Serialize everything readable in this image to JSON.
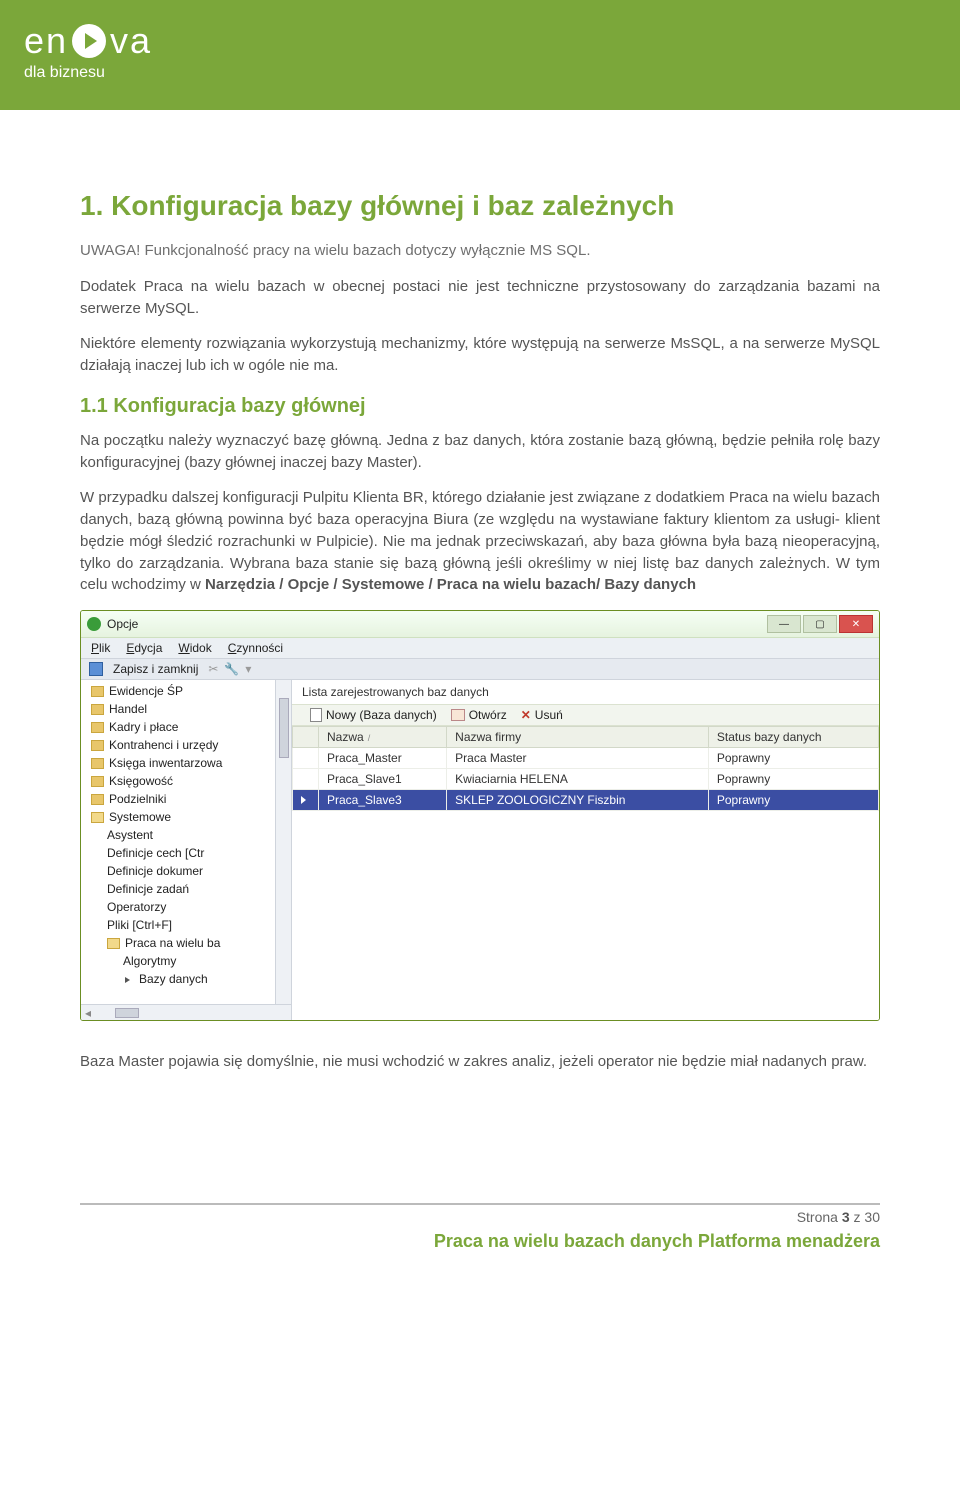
{
  "brand": {
    "name1": "en",
    "name2": "va",
    "tagline": "dla biznesu"
  },
  "doc": {
    "h1": "1. Konfiguracja bazy głównej i baz zależnych",
    "warn": "UWAGA! Funkcjonalność pracy na wielu bazach dotyczy wyłącznie MS SQL.",
    "p1": "Dodatek Praca na wielu bazach w obecnej postaci nie jest techniczne przystosowany do zarządzania bazami na serwerze MySQL.",
    "p2": "Niektóre elementy rozwiązania wykorzystują mechanizmy, które występują na serwerze MsSQL, a na serwerze MySQL działają inaczej lub ich w ogóle nie ma.",
    "h2": "1.1 Konfiguracja bazy głównej",
    "p3": "Na początku należy wyznaczyć bazę główną. Jedna z baz danych, która zostanie bazą główną, będzie pełniła rolę bazy konfiguracyjnej (bazy głównej inaczej bazy Master).",
    "p4a": "W przypadku dalszej konfiguracji Pulpitu Klienta BR, którego działanie jest związane z dodatkiem Praca na wielu bazach danych, bazą główną powinna być baza operacyjna Biura (ze względu na wystawiane faktury klientom za usługi- klient będzie mógł śledzić rozrachunki w Pulpicie). Nie ma jednak przeciwskazań, aby baza główna była bazą nieoperacyjną, tylko do zarządzania. Wybrana baza stanie się bazą główną jeśli określimy w niej listę baz danych zależnych. W tym celu wchodzimy w ",
    "p4b": "Narzędzia / Opcje / Systemowe / Praca na wielu bazach/ Bazy danych",
    "below": "Baza Master pojawia się domyślnie, nie musi wchodzić w zakres analiz, jeżeli operator nie będzie miał nadanych praw."
  },
  "window": {
    "title": "Opcje",
    "menu": [
      "Plik",
      "Edycja",
      "Widok",
      "Czynności"
    ],
    "save_close": "Zapisz i zamknij",
    "tree": [
      {
        "t": "folder",
        "label": "Ewidencje ŚP"
      },
      {
        "t": "folder",
        "label": "Handel"
      },
      {
        "t": "folder",
        "label": "Kadry i płace"
      },
      {
        "t": "folder",
        "label": "Kontrahenci i urzędy"
      },
      {
        "t": "folder",
        "label": "Księga inwentarzowa"
      },
      {
        "t": "folder",
        "label": "Księgowość"
      },
      {
        "t": "folder",
        "label": "Podzielniki"
      },
      {
        "t": "folder-open",
        "label": "Systemowe"
      },
      {
        "t": "sub",
        "label": "Asystent"
      },
      {
        "t": "sub",
        "label": "Definicje cech [Ctr"
      },
      {
        "t": "sub",
        "label": "Definicje dokumer"
      },
      {
        "t": "sub",
        "label": "Definicje zadań"
      },
      {
        "t": "sub",
        "label": "Operatorzy"
      },
      {
        "t": "sub",
        "label": "Pliki [Ctrl+F]"
      },
      {
        "t": "sub-folder",
        "label": "Praca na wielu ba"
      },
      {
        "t": "sub2",
        "label": "Algorytmy"
      },
      {
        "t": "sub2-arrow",
        "label": "Bazy danych"
      }
    ],
    "main_title": "Lista zarejestrowanych baz danych",
    "tools": {
      "new": "Nowy (Baza danych)",
      "open": "Otwórz",
      "del": "Usuń"
    },
    "columns": [
      "Nazwa",
      "Nazwa firmy",
      "Status bazy danych"
    ],
    "rows": [
      {
        "c": [
          "Praca_Master",
          "Praca Master",
          "Poprawny"
        ],
        "sel": false
      },
      {
        "c": [
          "Praca_Slave1",
          "Kwiaciarnia HELENA",
          "Poprawny"
        ],
        "sel": false
      },
      {
        "c": [
          "Praca_Slave3",
          "SKLEP ZOOLOGICZNY Fiszbin",
          "Poprawny"
        ],
        "sel": true
      }
    ]
  },
  "footer": {
    "page_label": "Strona ",
    "page_num": "3",
    "page_of": " z ",
    "page_total": "30",
    "title": "Praca na wielu bazach danych Platforma menadżera"
  }
}
